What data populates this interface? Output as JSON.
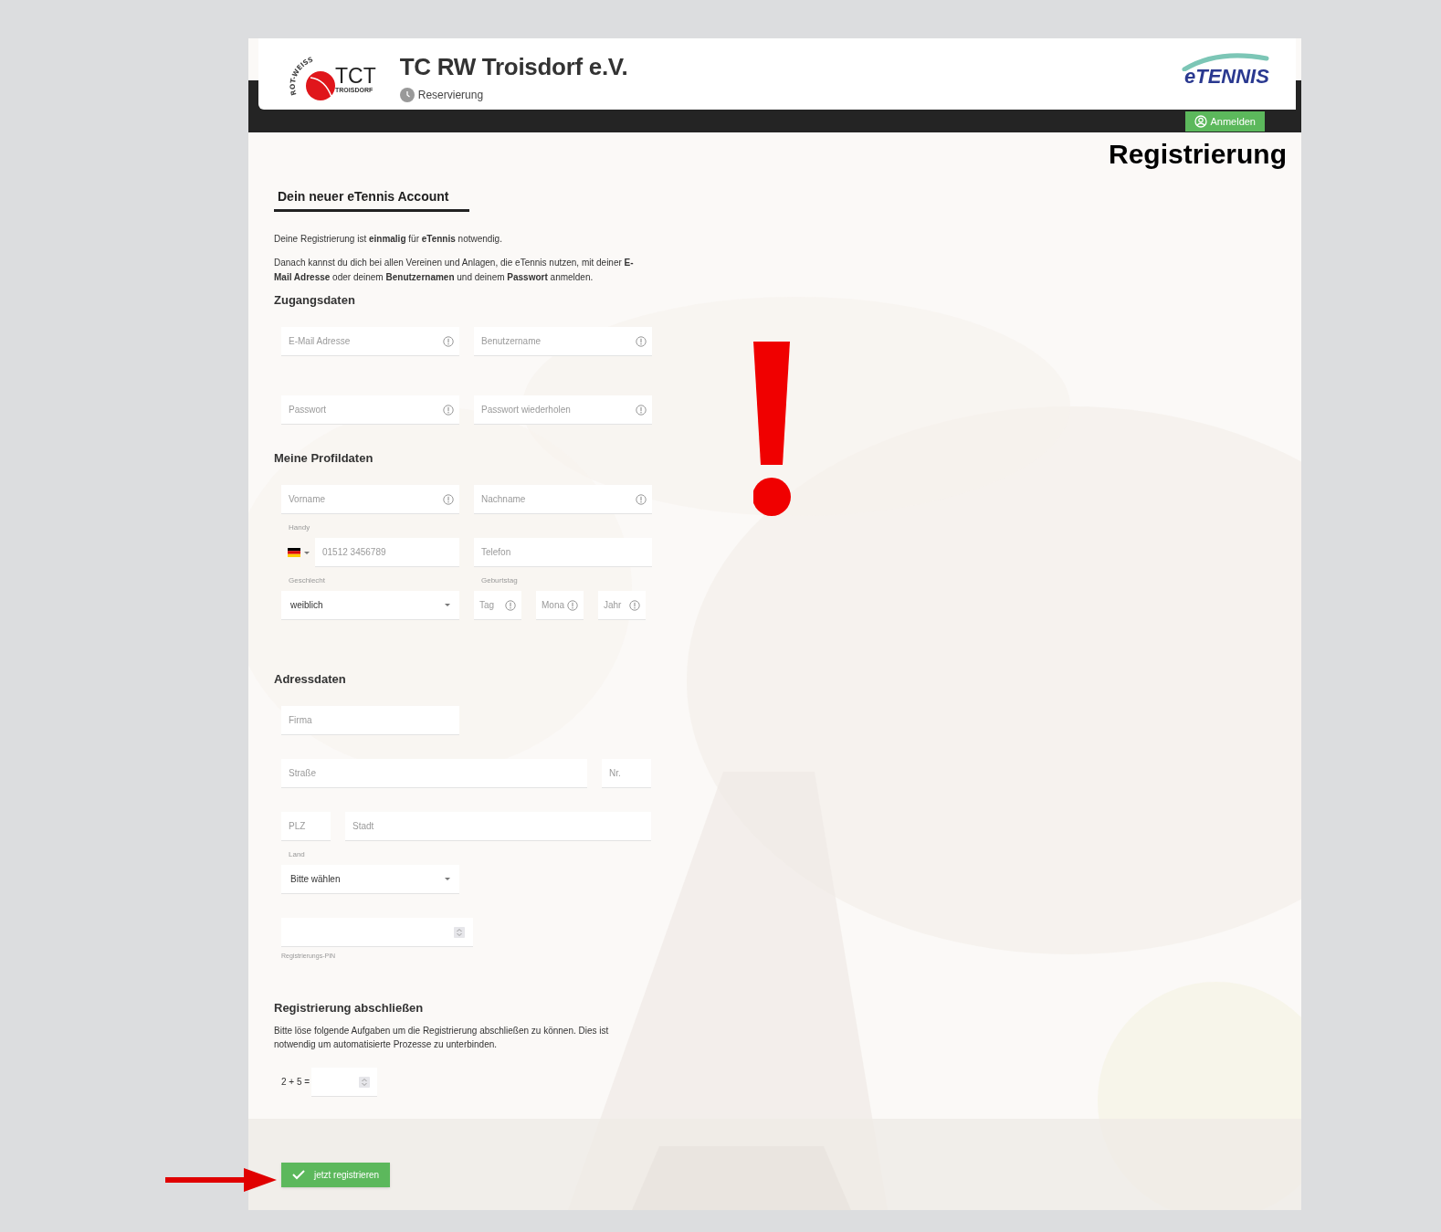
{
  "header": {
    "club_logo": {
      "arc_text": "ROT-WEISS",
      "initials": "TCT",
      "town": "TROISDORF"
    },
    "title": "TC RW Troisdorf e.V.",
    "subtitle": "Reservierung",
    "brand_logo": "eTENNIS",
    "login_button": "Anmelden"
  },
  "page_title": "Registrierung",
  "tab": "Dein neuer eTennis Account",
  "intro": [
    "Deine Registrierung ist **einmalig** für **eTennis** notwendig.",
    "Danach kannst du dich bei allen Vereinen und Anlagen, die eTennis nutzen, mit deiner **E-Mail Adresse** oder deinem **Benutzernamen** und deinem **Passwort** anmelden."
  ],
  "sections": [
    {
      "heading": "Zugangsdaten",
      "rows": [
        [
          {
            "kind": "text",
            "placeholder": "E-Mail Adresse",
            "info": true
          },
          {
            "kind": "text",
            "placeholder": "Benutzername",
            "info": true
          }
        ],
        [
          {
            "kind": "text",
            "placeholder": "Passwort",
            "info": true
          },
          {
            "kind": "text",
            "placeholder": "Passwort wiederholen",
            "info": true
          }
        ]
      ]
    },
    {
      "heading": "Meine Profildaten",
      "rows": [
        [
          {
            "kind": "text",
            "placeholder": "Vorname",
            "info": true
          },
          {
            "kind": "text",
            "placeholder": "Nachname",
            "info": true
          }
        ],
        [
          {
            "kind": "phone",
            "label": "Handy",
            "placeholder": "01512 3456789"
          },
          {
            "kind": "text",
            "placeholder": "Telefon",
            "info": false
          }
        ],
        [
          {
            "kind": "select",
            "label": "Geschlecht",
            "value": "weiblich"
          },
          {
            "kind": "date",
            "label": "Geburtstag",
            "parts": [
              {
                "placeholder": "Tag",
                "info": true
              },
              {
                "placeholder": "Mona",
                "info": true
              },
              {
                "placeholder": "Jahr",
                "info": true
              }
            ]
          }
        ]
      ]
    },
    {
      "heading": "Adressdaten",
      "rows": [
        [
          {
            "kind": "text",
            "placeholder": "Firma",
            "info": false
          }
        ],
        [
          {
            "kind": "long",
            "placeholder": "Straße",
            "info": false
          },
          {
            "kind": "short",
            "placeholder": "Nr.",
            "info": false
          }
        ],
        [
          {
            "kind": "short",
            "placeholder": "PLZ",
            "info": false
          },
          {
            "kind": "long",
            "placeholder": "Stadt",
            "info": false
          }
        ],
        [
          {
            "kind": "select",
            "label": "Land",
            "value": "Bitte wählen"
          }
        ],
        [
          {
            "kind": "pin",
            "label": "Registrierungs-PIN"
          }
        ]
      ]
    }
  ],
  "finish": {
    "heading": "Registrierung abschließen",
    "text": "Bitte löse folgende Aufgaben um die Registrierung abschließen zu können. Dies ist notwendig um automatisierte Prozesse zu unterbinden.",
    "captcha": "2 + 5 =",
    "button": "jetzt registrieren"
  }
}
